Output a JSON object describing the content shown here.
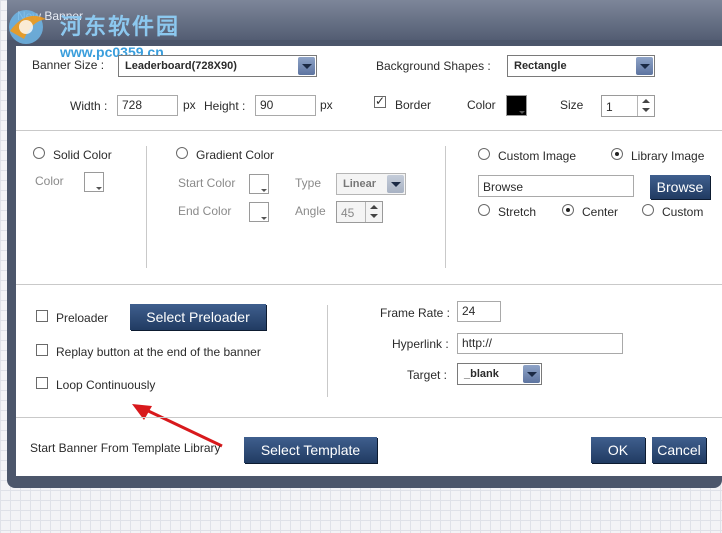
{
  "window": {
    "title": "New Banner"
  },
  "watermark": {
    "site_name": "河东软件园",
    "url": "www.pc0359.cn"
  },
  "banner_size": {
    "label": "Banner Size :",
    "value": "Leaderboard(728X90)"
  },
  "background_shapes": {
    "label": "Background Shapes :",
    "value": "Rectangle"
  },
  "width": {
    "label": "Width :",
    "value": "728",
    "unit": "px"
  },
  "height": {
    "label": "Height :",
    "value": "90",
    "unit": "px"
  },
  "border": {
    "label": "Border",
    "checked": true,
    "check_glyph": "✓"
  },
  "color": {
    "label": "Color",
    "value": "#000000"
  },
  "size": {
    "label": "Size",
    "value": "1"
  },
  "solid_color": {
    "label": "Solid Color",
    "color_label": "Color"
  },
  "gradient_color": {
    "label": "Gradient Color",
    "start_label": "Start Color",
    "end_label": "End Color",
    "type_label": "Type",
    "type_value": "Linear",
    "angle_label": "Angle",
    "angle_value": "45"
  },
  "image": {
    "custom_label": "Custom Image",
    "library_label": "Library Image",
    "selected": "library",
    "path_value": "Browse",
    "browse_button": "Browse",
    "stretch_label": "Stretch",
    "center_label": "Center",
    "custom_pos_label": "Custom",
    "position_selected": "center"
  },
  "preloader": {
    "label": "Preloader",
    "button": "Select Preloader"
  },
  "replay": {
    "label": "Replay button at the end of the banner"
  },
  "loop": {
    "label": "Loop Continuously"
  },
  "frame_rate": {
    "label": "Frame Rate :",
    "value": "24"
  },
  "hyperlink": {
    "label": "Hyperlink :",
    "value": "http://"
  },
  "target": {
    "label": "Target :",
    "value": "_blank"
  },
  "template": {
    "label": "Start Banner From Template Library",
    "button": "Select Template"
  },
  "footer": {
    "ok": "OK",
    "cancel": "Cancel"
  },
  "colors": {
    "accent": "#2d4a78",
    "arrow": "#d8191c",
    "frame": "#4c566b"
  }
}
